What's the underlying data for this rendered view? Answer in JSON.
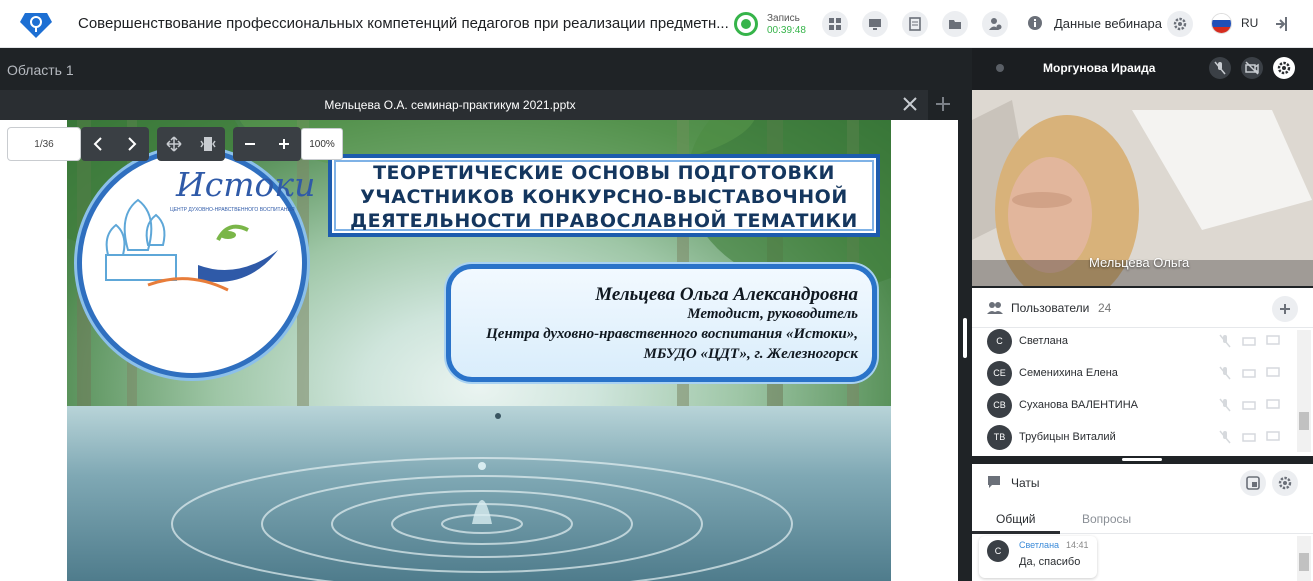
{
  "header": {
    "title": "Совершенствование профессиональных компетенций педагогов при реализации предметн...",
    "record_label": "Запись",
    "record_time": "00:39:48",
    "webinar_data_label": "Данные вебинара",
    "language": "RU"
  },
  "area": {
    "title": "Область 1"
  },
  "file": {
    "name": "Мельцева О.А. семинар-практикум 2021.pptx"
  },
  "slide_toolbar": {
    "page": "1/36",
    "zoom": "100%"
  },
  "slide": {
    "logo_title": "Истоки",
    "logo_subtitle": "ЦЕНТР ДУХОВНО-НРАВСТВЕННОГО ВОСПИТАНИЯ",
    "title_lines": [
      "ТЕОРЕТИЧЕСКИЕ ОСНОВЫ ПОДГОТОВКИ",
      "УЧАСТНИКОВ КОНКУРСНО-ВЫСТАВОЧНОЙ",
      "ДЕЯТЕЛЬНОСТИ ПРАВОСЛАВНОЙ ТЕМАТИКИ"
    ],
    "author": "Мельцева Ольга Александровна",
    "author_lines": [
      "Методист, руководитель",
      "Центра духовно-нравственного воспитания «Истоки»,",
      "МБУДО «ЦДТ», г. Железногорск"
    ]
  },
  "speaker": {
    "name": "Моргунова Ираида",
    "video_name": "Мельцева Ольга"
  },
  "users": {
    "title": "Пользователи",
    "count": "24",
    "list": [
      {
        "initials": "С",
        "name": "Светлана"
      },
      {
        "initials": "СЕ",
        "name": "Семенихина Елена"
      },
      {
        "initials": "СВ",
        "name": "Суханова ВАЛЕНТИНА"
      },
      {
        "initials": "ТВ",
        "name": "Трубицын Виталий"
      }
    ]
  },
  "chat": {
    "title": "Чаты",
    "tabs": [
      "Общий",
      "Вопросы"
    ],
    "messages": [
      {
        "initials": "С",
        "author": "Светлана",
        "time": "14:41",
        "text": "Да, спасибо"
      }
    ]
  },
  "colors": {
    "accent": "#36b44a",
    "brand_blue": "#1d5cae",
    "dark_panel": "#1f2326"
  },
  "icons": {
    "logo": "webinar-logo-icon",
    "toolbar": [
      "apps-icon",
      "screen-icon",
      "document-icon",
      "folder-icon",
      "users-settings-icon",
      "info-icon",
      "gear-icon",
      "exit-icon"
    ]
  }
}
